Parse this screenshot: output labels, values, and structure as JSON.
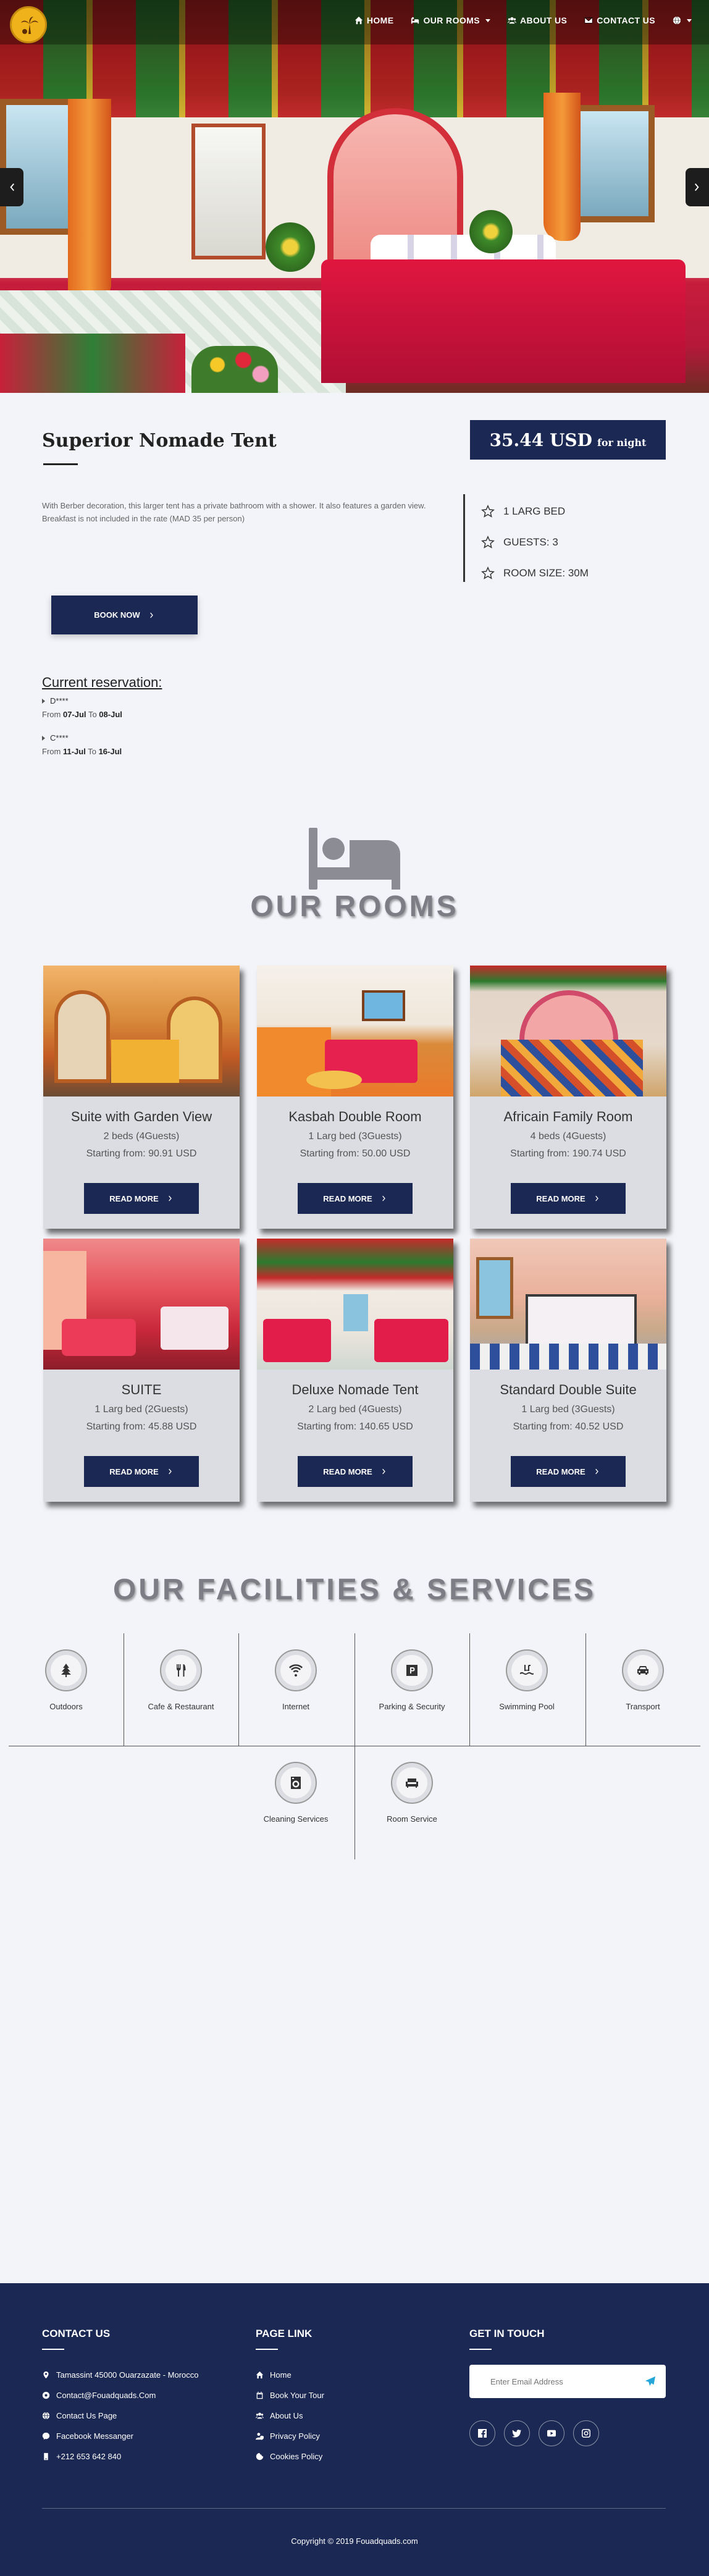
{
  "nav": {
    "items": [
      {
        "label": "HOME",
        "icon": "home-icon"
      },
      {
        "label": "OUR ROOMS",
        "icon": "bed-icon"
      },
      {
        "label": "ABOUT US",
        "icon": "users-icon"
      },
      {
        "label": "CONTACT US",
        "icon": "envelope-icon"
      }
    ],
    "language_icon": "globe-icon"
  },
  "room": {
    "title": "Superior Nomade Tent",
    "price": "35.44 USD",
    "per": "for night",
    "description": "With Berber decoration, this larger tent has a private bathroom with a shower. It also features a garden view. Breakfast is not included in the rate (MAD 35 per person)",
    "features": [
      "1 LARG BED",
      "GUESTS: 3",
      "ROOM SIZE: 30M"
    ],
    "book_label": "BOOK NOW"
  },
  "reservations": {
    "title": "Current reservation:",
    "items": [
      {
        "name": "D****",
        "from_label": "From",
        "from": "07-Jul",
        "to_label": "To",
        "to": "08-Jul"
      },
      {
        "name": "C****",
        "from_label": "From",
        "from": "11-Jul",
        "to_label": "To",
        "to": "16-Jul"
      }
    ]
  },
  "rooms_section": {
    "title": "OUR ROOMS",
    "read_more": "READ MORE",
    "cards": [
      {
        "name": "Suite with Garden View",
        "beds": "2 beds (4Guests)",
        "from": "Starting from: 90.91 USD"
      },
      {
        "name": "Kasbah Double Room",
        "beds": "1 Larg bed (3Guests)",
        "from": "Starting from: 50.00 USD"
      },
      {
        "name": "Africain Family Room",
        "beds": "4 beds (4Guests)",
        "from": "Starting from: 190.74 USD"
      },
      {
        "name": "SUITE",
        "beds": "1 Larg bed (2Guests)",
        "from": "Starting from: 45.88 USD"
      },
      {
        "name": "Deluxe Nomade Tent",
        "beds": "2 Larg bed (4Guests)",
        "from": "Starting from: 140.65 USD"
      },
      {
        "name": "Standard Double Suite",
        "beds": "1 Larg bed (3Guests)",
        "from": "Starting from: 40.52 USD"
      }
    ]
  },
  "facilities": {
    "title": "OUR FACILITIES & SERVICES",
    "items": [
      {
        "label": "Outdoors",
        "icon": "tree-icon"
      },
      {
        "label": "Cafe & Restaurant",
        "icon": "utensils-icon"
      },
      {
        "label": "Internet",
        "icon": "wifi-icon"
      },
      {
        "label": "Parking & Security",
        "icon": "parking-icon"
      },
      {
        "label": "Swimming Pool",
        "icon": "swimmer-icon"
      },
      {
        "label": "Transport",
        "icon": "car-icon"
      },
      {
        "label": "Cleaning Services",
        "icon": "washing-machine-icon"
      },
      {
        "label": "Room Service",
        "icon": "couch-icon"
      }
    ]
  },
  "footer": {
    "contact": {
      "title": "CONTACT US",
      "items": [
        {
          "text": "Tamassint 45000 Ouarzazate - Morocco",
          "icon": "map-marker-icon"
        },
        {
          "text": "Contact@Fouadquads.Com",
          "icon": "at-icon"
        },
        {
          "text": "Contact Us Page",
          "icon": "globe-icon"
        },
        {
          "text": "Facebook Messanger",
          "icon": "messenger-icon"
        },
        {
          "text": "+212 653 642 840",
          "icon": "phone-icon"
        }
      ]
    },
    "pages": {
      "title": "PAGE LINK",
      "items": [
        {
          "text": "Home",
          "icon": "home-icon"
        },
        {
          "text": "Book Your Tour",
          "icon": "calendar-icon"
        },
        {
          "text": "About Us",
          "icon": "users-icon"
        },
        {
          "text": "Privacy Policy",
          "icon": "user-shield-icon"
        },
        {
          "text": "Cookies Policy",
          "icon": "cookie-icon"
        }
      ]
    },
    "touch": {
      "title": "GET IN TOUCH",
      "email_placeholder": "Enter Email Address",
      "socials": [
        "facebook-icon",
        "twitter-icon",
        "youtube-icon",
        "instagram-icon"
      ]
    },
    "copyright": "Copyright © 2019 Fouadquads.com"
  },
  "colors": {
    "navy": "#1b2853",
    "page_bg": "#f3f4f9",
    "card_bg": "#dcdde2",
    "send_accent": "#24a6d9"
  }
}
